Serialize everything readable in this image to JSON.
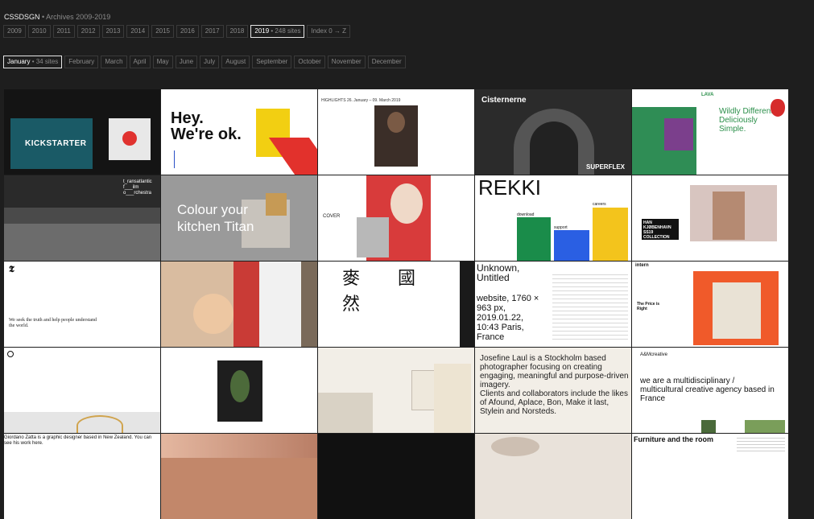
{
  "header": {
    "brand": "CSSDSGN",
    "sub": " • Archives 2009-2019"
  },
  "years": [
    {
      "label": "2009"
    },
    {
      "label": "2010"
    },
    {
      "label": "2011"
    },
    {
      "label": "2012"
    },
    {
      "label": "2013"
    },
    {
      "label": "2014"
    },
    {
      "label": "2015"
    },
    {
      "label": "2016"
    },
    {
      "label": "2017"
    },
    {
      "label": "2018"
    },
    {
      "label": "2019",
      "count": " • 248 sites"
    },
    {
      "label": "Index 0 → Z"
    }
  ],
  "months": [
    {
      "label": "January",
      "count": " • 34 sites"
    },
    {
      "label": "February"
    },
    {
      "label": "March"
    },
    {
      "label": "April"
    },
    {
      "label": "May"
    },
    {
      "label": "June"
    },
    {
      "label": "July"
    },
    {
      "label": "August"
    },
    {
      "label": "September"
    },
    {
      "label": "October"
    },
    {
      "label": "November"
    },
    {
      "label": "December"
    }
  ],
  "tiles": {
    "t1": "KICKSTARTER",
    "t2a": "Hey.",
    "t2b": "We're ok.",
    "t3": "HIGHLIGHTS 26. January – 09. March 2019",
    "t4a": "Cisternerne",
    "t4b": "SUPERFLEX",
    "t5a": "Wildly Different, Deliciously Simple.",
    "t5b": "LAVA",
    "t6a": "t_ransatlantic",
    "t6b": "f___ilm",
    "t6c": "o___rchestra",
    "t7": "Colour your kitchen Titan",
    "t8": "COVER",
    "t9a": "REKKI",
    "t9b": "download",
    "t9c": "careers",
    "t9d": "support",
    "t10": "HAN KJØBENHAVN SS19 COLLECTION",
    "t11": "We seek the truth and help people understand the world.",
    "t13": "麥 國 然",
    "t14a": "Unknown, Untitled",
    "t14b": "website, 1760 × 963 px, 2019.01.22, 10:43 Paris, France",
    "t15a": "intern",
    "t15b": "The Price is Right",
    "t19a": "Josefine Laul is a Stockholm based photographer focusing on creating engaging, meaningful and purpose-driven imagery.",
    "t19b": "Clients and collaborators include the likes of Afound, Aplace, Bon, Make it last, Stylein and Norsteds.",
    "t20a": "A&Mcreative",
    "t20b": "we are a multidisciplinary / multicultural creative agency based in France",
    "t21": "Giordano Zatta is a graphic designer based in New Zealand. You can see his work here.",
    "t25": "Furniture and the room"
  }
}
